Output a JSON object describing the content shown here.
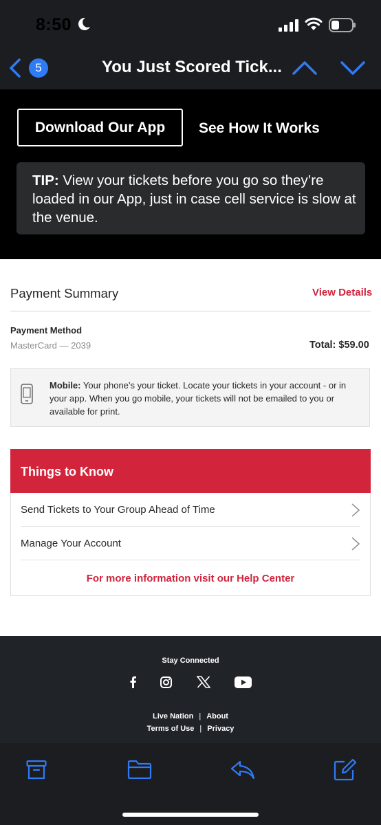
{
  "status_bar": {
    "time": "8:50"
  },
  "nav": {
    "badge": "5",
    "title": "You Just Scored Tick..."
  },
  "email_header": {
    "download_label": "Download Our App",
    "how_label": "See How It Works",
    "tip_label": "TIP:",
    "tip_text": " View your tickets before you go so they’re loaded in our App, just in case cell service is slow at the venue."
  },
  "payment": {
    "title": "Payment Summary",
    "view_details": "View Details",
    "method_label": "Payment Method",
    "method_value": "MasterCard — 2039",
    "total": "Total: $59.00"
  },
  "mobile_notice": {
    "label": "Mobile:",
    "text": " Your phone’s your ticket. Locate your tickets in your account - or in your app. When you go mobile, your tickets will not be emailed to you or available for print."
  },
  "things_to_know": {
    "title": "Things to Know",
    "items": [
      "Send Tickets to Your Group Ahead of Time",
      "Manage Your Account"
    ],
    "help": "For more information visit our Help Center"
  },
  "footer": {
    "stay_connected": "Stay Connected",
    "social": [
      "facebook-icon",
      "instagram-icon",
      "x-icon",
      "youtube-icon"
    ],
    "links": [
      "Live Nation",
      "About",
      "Terms of Use",
      "Privacy"
    ],
    "separator": "|"
  },
  "toolbar": {
    "icons": [
      "archive-icon",
      "folder-icon",
      "reply-icon",
      "compose-icon"
    ]
  },
  "colors": {
    "accent_red": "#d2253c",
    "ios_blue": "#2f7bf6",
    "dark_bg": "#1c1d20",
    "footer_bg": "#202429"
  }
}
